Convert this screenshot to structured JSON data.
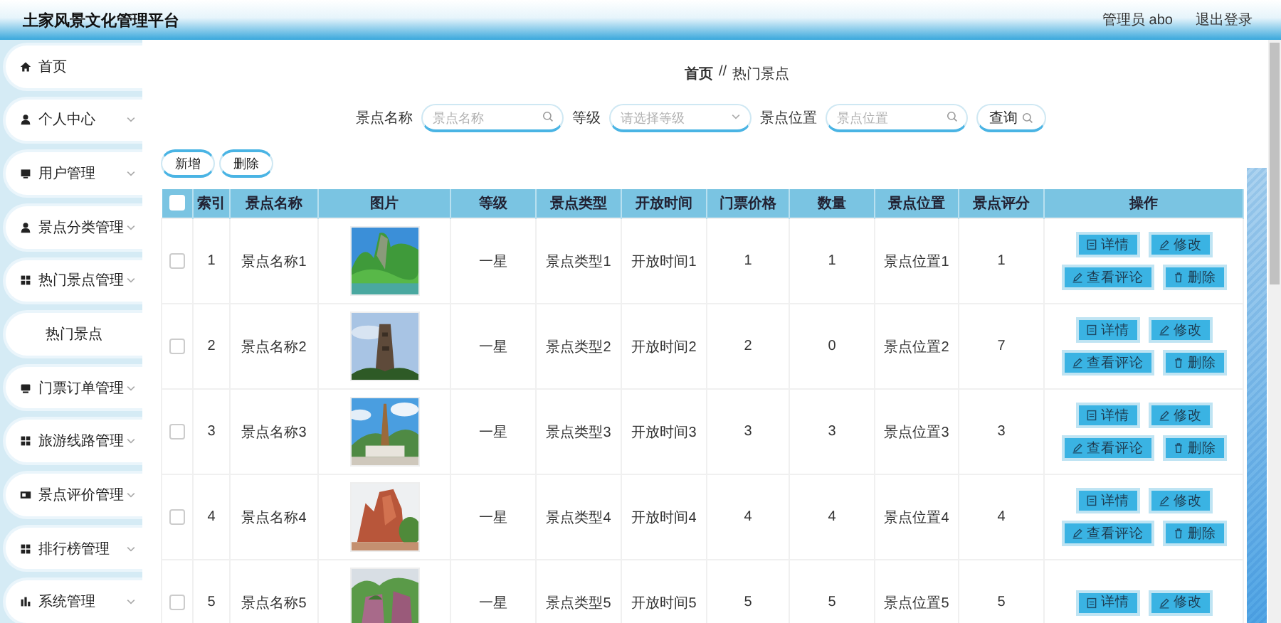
{
  "header": {
    "title": "土家风景文化管理平台",
    "user": "管理员 abo",
    "logout": "退出登录"
  },
  "sidebar": {
    "items": [
      {
        "label": "首页"
      },
      {
        "label": "个人中心"
      },
      {
        "label": "用户管理"
      },
      {
        "label": "景点分类管理"
      },
      {
        "label": "热门景点管理",
        "children": [
          {
            "label": "热门景点"
          }
        ]
      },
      {
        "label": "门票订单管理"
      },
      {
        "label": "旅游线路管理"
      },
      {
        "label": "景点评价管理"
      },
      {
        "label": "排行榜管理"
      },
      {
        "label": "系统管理"
      }
    ]
  },
  "breadcrumb": {
    "items": [
      "首页",
      "热门景点"
    ],
    "separator": "//"
  },
  "search": {
    "fields": [
      {
        "label": "景点名称",
        "placeholder": "景点名称",
        "kind": "input"
      },
      {
        "label": "等级",
        "placeholder": "请选择等级",
        "kind": "select"
      },
      {
        "label": "景点位置",
        "placeholder": "景点位置",
        "kind": "input"
      }
    ],
    "button": "查询"
  },
  "toolbar": [
    "新增",
    "删除"
  ],
  "table": {
    "all_checked": false,
    "columns": [
      "索引",
      "景点名称",
      "图片",
      "等级",
      "景点类型",
      "开放时间",
      "门票价格",
      "数量",
      "景点位置",
      "景点评分",
      "操作"
    ],
    "rows": [
      {
        "checked": false,
        "cells": [
          "1",
          "景点名称1",
          "",
          "一星",
          "景点类型1",
          "开放时间1",
          "1",
          "1",
          "景点位置1",
          "1"
        ],
        "actions": [
          {
            "label": "详情",
            "kind": "detail"
          },
          {
            "label": "修改",
            "kind": "edit"
          },
          {
            "label": "查看评论",
            "kind": "edit"
          },
          {
            "label": "删除",
            "kind": "delete"
          }
        ]
      },
      {
        "checked": false,
        "cells": [
          "2",
          "景点名称2",
          "",
          "一星",
          "景点类型2",
          "开放时间2",
          "2",
          "0",
          "景点位置2",
          "7"
        ],
        "actions": [
          {
            "label": "详情",
            "kind": "detail"
          },
          {
            "label": "修改",
            "kind": "edit"
          },
          {
            "label": "查看评论",
            "kind": "edit"
          },
          {
            "label": "删除",
            "kind": "delete"
          }
        ]
      },
      {
        "checked": false,
        "cells": [
          "3",
          "景点名称3",
          "",
          "一星",
          "景点类型3",
          "开放时间3",
          "3",
          "3",
          "景点位置3",
          "3"
        ],
        "actions": [
          {
            "label": "详情",
            "kind": "detail"
          },
          {
            "label": "修改",
            "kind": "edit"
          },
          {
            "label": "查看评论",
            "kind": "edit"
          },
          {
            "label": "删除",
            "kind": "delete"
          }
        ]
      },
      {
        "checked": false,
        "cells": [
          "4",
          "景点名称4",
          "",
          "一星",
          "景点类型4",
          "开放时间4",
          "4",
          "4",
          "景点位置4",
          "4"
        ],
        "actions": [
          {
            "label": "详情",
            "kind": "detail"
          },
          {
            "label": "修改",
            "kind": "edit"
          },
          {
            "label": "查看评论",
            "kind": "edit"
          },
          {
            "label": "删除",
            "kind": "delete"
          }
        ]
      },
      {
        "checked": false,
        "cells": [
          "5",
          "景点名称5",
          "",
          "一星",
          "景点类型5",
          "开放时间5",
          "5",
          "5",
          "景点位置5",
          "5"
        ],
        "actions": [
          {
            "label": "详情",
            "kind": "detail"
          },
          {
            "label": "修改",
            "kind": "edit"
          }
        ]
      }
    ]
  }
}
